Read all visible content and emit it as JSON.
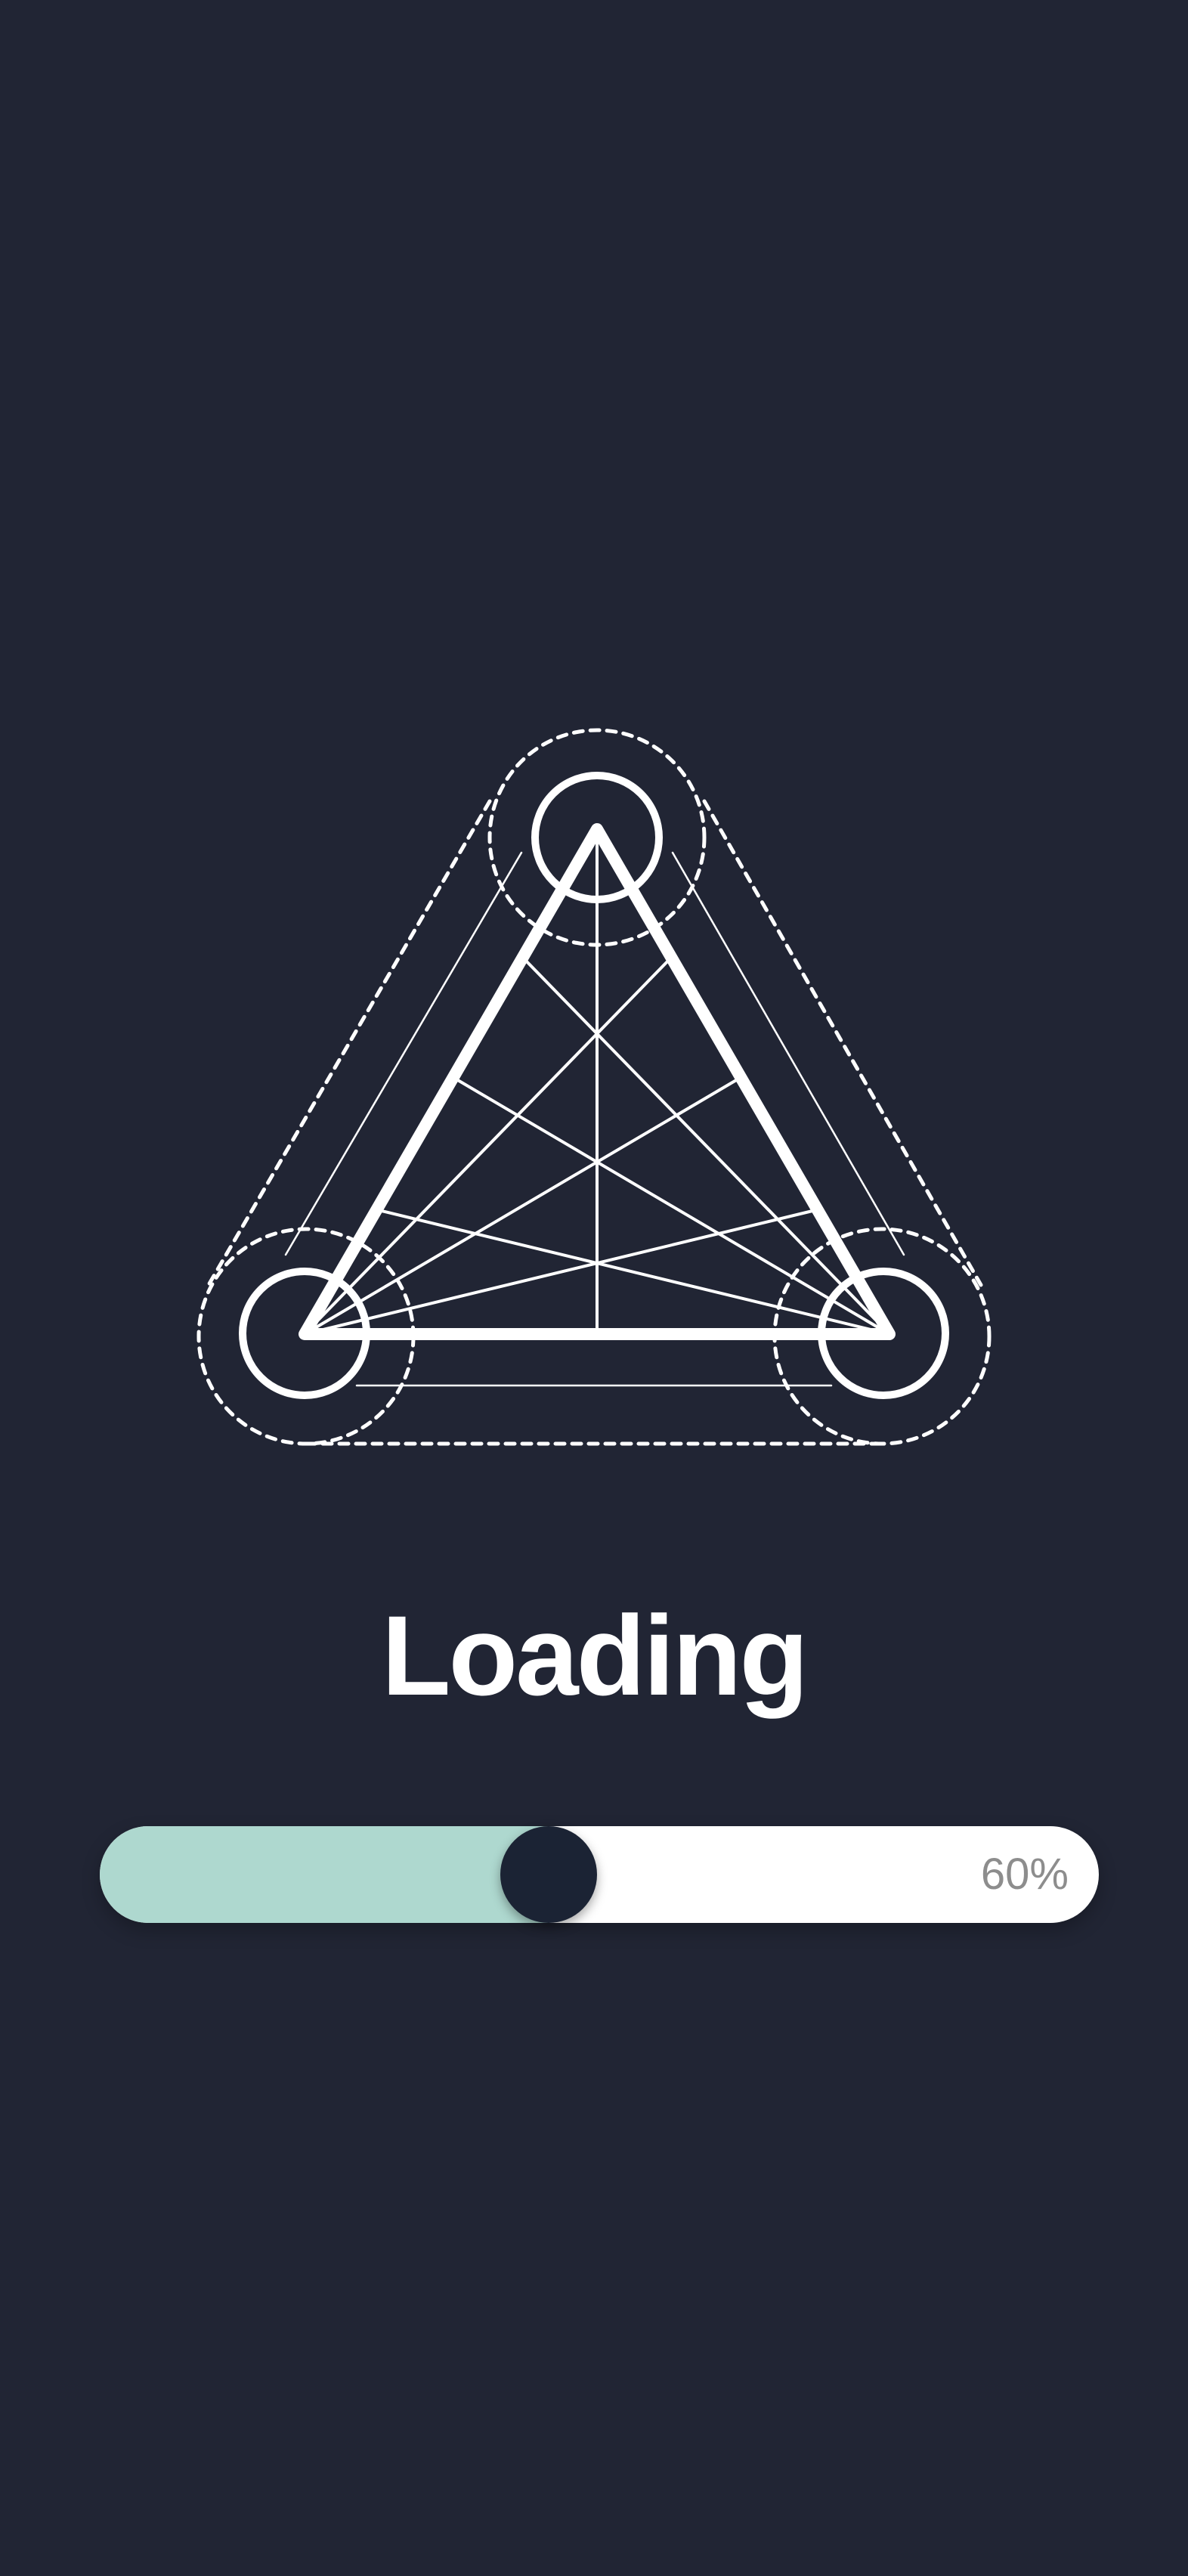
{
  "screen": {
    "title": "Loading",
    "background_color": "#212534"
  },
  "logo": {
    "icon": "geometric-triangle-icon",
    "stroke_color": "#ffffff"
  },
  "progress": {
    "value_percent": 60,
    "label": "60%",
    "fill_color": "#aed8cf",
    "track_color": "#ffffff",
    "knob_color": "#1b2334"
  }
}
